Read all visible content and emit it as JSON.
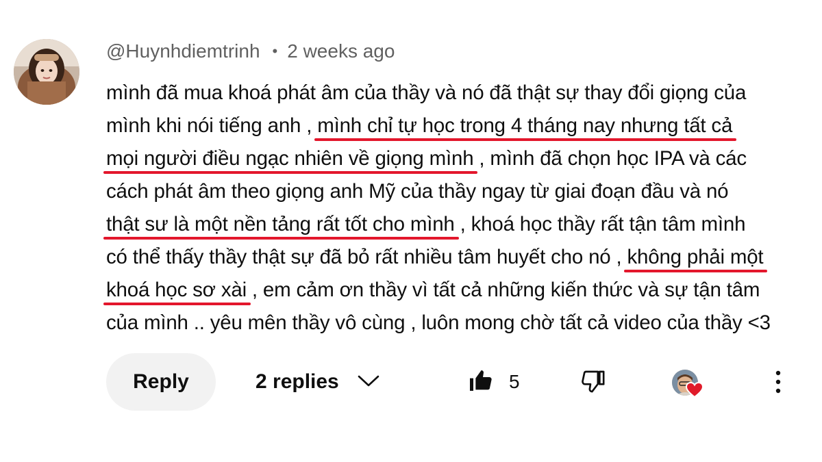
{
  "comment": {
    "author": "@Huynhdiemtrinh",
    "separator": "•",
    "timestamp": "2 weeks ago",
    "lines": [
      [
        {
          "text": "mình đã mua khoá phát âm của thầy và nó đã thật sự thay đổi giọng của",
          "highlight": false
        }
      ],
      [
        {
          "text": "mình khi nói tiếng anh , ",
          "highlight": false
        },
        {
          "text": "mình chỉ tự học trong 4 tháng nay nhưng tất cả",
          "highlight": true
        }
      ],
      [
        {
          "text": "mọi người điều ngạc nhiên về giọng mình",
          "highlight": true
        },
        {
          "text": " , mình đã chọn học IPA và các",
          "highlight": false
        }
      ],
      [
        {
          "text": "cách phát âm theo giọng anh Mỹ của thầy ngay từ giai đoạn đầu và nó",
          "highlight": false
        }
      ],
      [
        {
          "text": "thật sư là một nền tảng rất tốt cho mình",
          "highlight": true
        },
        {
          "text": " , khoá học thầy rất tận tâm mình",
          "highlight": false
        }
      ],
      [
        {
          "text": "có thể thấy thầy thật sự đã bỏ rất nhiều tâm huyết cho nó , ",
          "highlight": false
        },
        {
          "text": "không phải một",
          "highlight": true
        }
      ],
      [
        {
          "text": "khoá học sơ xài",
          "highlight": true
        },
        {
          "text": " , em cảm ơn thầy vì tất cả những kiến thức và sự tận tâm",
          "highlight": false
        }
      ],
      [
        {
          "text": "của mình .. yêu mên thầy vô cùng , luôn mong chờ tất cả video của thầy <3",
          "highlight": false
        }
      ]
    ],
    "highlight_color": "#e3172c"
  },
  "actions": {
    "reply_label": "Reply",
    "replies_label": "2 replies",
    "like_count": "5",
    "icons": {
      "toggle": "chevron-down-icon",
      "like": "thumbs-up-icon",
      "dislike": "thumbs-down-icon",
      "creator": "creator-heart-icon",
      "more": "more-vert-icon"
    }
  }
}
